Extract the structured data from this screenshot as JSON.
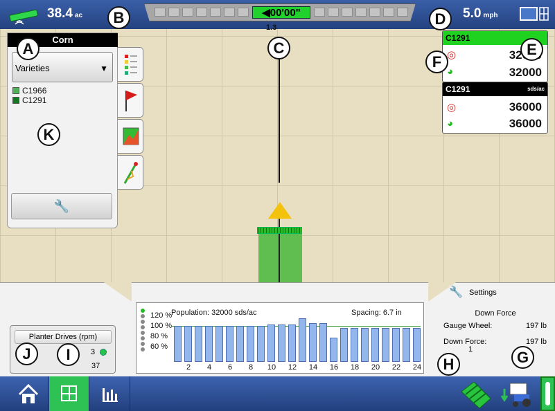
{
  "topbar": {
    "area_value": "38.4",
    "area_unit": "ac",
    "speed_value": "5.0",
    "speed_unit": "mph",
    "lightbar_offset": "00'00\"",
    "lightbar_subtext": "1.3",
    "icons": [
      "gps-satellite-icon",
      "display-toggle-icon"
    ]
  },
  "left_panel": {
    "crop": "Corn",
    "dropdown": "Varieties",
    "legend": [
      {
        "label": "C1966",
        "color": "#52b25a"
      },
      {
        "label": "C1291",
        "color": "#117a22"
      }
    ],
    "tabs": [
      "legend-tab",
      "flag-tab",
      "map-layer-tab",
      "guidance-tab"
    ]
  },
  "rate_panels": [
    {
      "product": "C1291",
      "unit": "",
      "target": "32000",
      "actual": "32000",
      "header_color": "#1fd21f"
    },
    {
      "product": "C1291",
      "unit": "sds/ac",
      "target": "36000",
      "actual": "36000",
      "header_color": "#000000"
    }
  ],
  "population_chart": {
    "population_text": "Population: 32000 sds/ac",
    "spacing_text": "Spacing: 6.7 in",
    "y_ticks": [
      "120 %",
      "100 %",
      "80 %",
      "60 %"
    ]
  },
  "chart_data": {
    "type": "bar",
    "categories": [
      "1",
      "2",
      "3",
      "4",
      "5",
      "6",
      "7",
      "8",
      "9",
      "10",
      "11",
      "12",
      "13",
      "14",
      "15",
      "16",
      "17",
      "18",
      "19",
      "20",
      "21",
      "22",
      "23",
      "24"
    ],
    "x_tick_labels": [
      "2",
      "4",
      "6",
      "8",
      "10",
      "12",
      "14",
      "16",
      "18",
      "20",
      "22",
      "24"
    ],
    "values": [
      100,
      100,
      100,
      100,
      100,
      100,
      100,
      100,
      100,
      102,
      102,
      102,
      111,
      104,
      104,
      84,
      97,
      97,
      97,
      97,
      97,
      97,
      97,
      97
    ],
    "ylim": [
      50,
      125
    ],
    "ylabel": "",
    "xlabel": "",
    "title": "",
    "target_line": 100
  },
  "drives": {
    "title": "Planter Drives (rpm)",
    "drive_number": "3",
    "rpm": "37"
  },
  "settings": {
    "label": "Settings",
    "section": "Down Force",
    "rows": [
      {
        "label": "Gauge Wheel:",
        "value": "197 lb"
      },
      {
        "label": "Down Force:",
        "value": "197 lb",
        "sub": "1"
      }
    ]
  },
  "nav": {
    "buttons": [
      "home-icon",
      "map-view-icon",
      "bar-chart-icon"
    ]
  },
  "callouts": [
    "A",
    "B",
    "C",
    "D",
    "E",
    "F",
    "G",
    "H",
    "I",
    "J",
    "K"
  ]
}
